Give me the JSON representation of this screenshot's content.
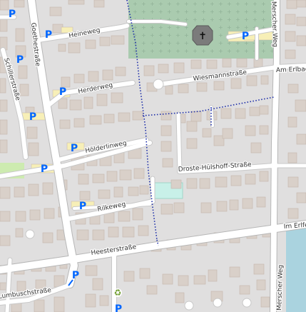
{
  "map": {
    "colors": {
      "background": "#e0dfdf",
      "building": "#d9d0c9",
      "building_stroke": "#c4b6ab",
      "road": "#ffffff",
      "road_casing": "#c8c8c8",
      "major_road_casing": "#b7b7b7",
      "cemetery": "#aacbaf",
      "grave_cross": "#8fb096",
      "parking_area": "#eeeeee",
      "parking_symbol": "#0066ff",
      "parking_fill": "#f7efb7",
      "footpath": "#1a2ba8",
      "water": "#aad3df",
      "playground": "#c8f0e8",
      "grass": "#cdebb0",
      "recycling": "#6b9a28"
    },
    "streets": {
      "goethestrasse": "Goethestraße",
      "schillerstrasse": "Schillerstraße",
      "heineweg": "Heineweg",
      "herderweg": "Herderweg",
      "hoelderlinweg": "Hölderlinweg",
      "rilkeweg": "Rilkeweg",
      "heesterstrasse": "Heesterstraße",
      "lumbuschstrasse": "Lumbuschstraße",
      "wiesmannstrasse": "Wiesmannstraße",
      "am_erlbach": "Am Erlbac",
      "droste": "Droste-Hülshoff-Straße",
      "merscher_weg_north": "Merscher Weg",
      "merscher_weg_south": "Merscher Weg",
      "im_erlfeld": "Im Erlfel"
    },
    "parking_label": "P",
    "icons": {
      "parking": "parking-icon",
      "chapel": "chapel-cross-icon",
      "recycling": "recycling-icon"
    }
  }
}
